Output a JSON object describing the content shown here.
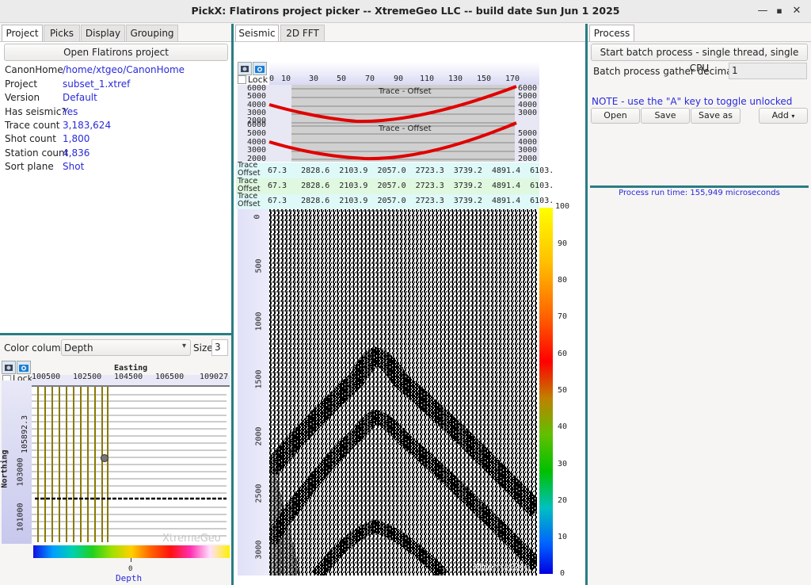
{
  "window": {
    "title": "PickX: Flatirons project picker -- XtremeGeo LLC -- build date Sun Jun 1 2025"
  },
  "left": {
    "tabs": [
      "Project",
      "Picks",
      "Display",
      "Grouping"
    ],
    "open_button": "Open Flatirons project",
    "info": [
      {
        "label": "CanonHome",
        "value": "/home/xtgeo/CanonHome"
      },
      {
        "label": "Project",
        "value": "subset_1.xtref"
      },
      {
        "label": "Version",
        "value": "Default"
      },
      {
        "label": "Has seismic?",
        "value": "Yes"
      },
      {
        "label": "Trace count",
        "value": "3,183,624"
      },
      {
        "label": "Shot count",
        "value": "1,800"
      },
      {
        "label": "Station count",
        "value": "4,836"
      },
      {
        "label": "Sort plane",
        "value": "Shot"
      }
    ]
  },
  "map": {
    "color_column_label": "Color column",
    "color_column_value": "Depth",
    "size_label": "Size",
    "size_value": "3",
    "lock_label": "Lock",
    "x_title": "Easting",
    "x_ticks": [
      "100500",
      "102500",
      "104500",
      "106500",
      "109027"
    ],
    "y_title": "Northing",
    "y_ticks": [
      "105892.3",
      "103000",
      "101000"
    ],
    "watermark": "XtremeGeo",
    "colorbar_tick": "0",
    "colorbar_label": "Depth"
  },
  "center": {
    "tabs": [
      "Seismic",
      "2D FFT"
    ],
    "lock_label": "Lock",
    "trace_axis": [
      "0",
      "10",
      "30",
      "50",
      "70",
      "90",
      "110",
      "130",
      "150",
      "170"
    ],
    "plot_title": "Trace - Offset",
    "offset_yticks_a": [
      "6000",
      "5000",
      "4000",
      "3000",
      "2000"
    ],
    "offset_yticks_b": [
      "6000",
      "5000",
      "4000",
      "3000",
      "2000"
    ],
    "header_rows": [
      {
        "label1": "Trace",
        "label2": "Offset",
        "values": "67.3   2828.6  2103.9  2057.0  2723.3  3739.2  4891.4  6103."
      },
      {
        "label1": "Trace",
        "label2": "Offset",
        "values": "67.3   2828.6  2103.9  2057.0  2723.3  3739.2  4891.4  6103."
      },
      {
        "label1": "Trace",
        "label2": "Offset",
        "values": "67.3   2828.6  2103.9  2057.0  2723.3  3739.2  4891.4  6103."
      }
    ],
    "time_ticks": [
      "0",
      "500",
      "1000",
      "1500",
      "2000",
      "2500",
      "3000"
    ],
    "colorbar_ticks": [
      "100",
      "90",
      "80",
      "70",
      "60",
      "50",
      "40",
      "30",
      "20",
      "10",
      "0"
    ],
    "watermark": "XtremeGeo"
  },
  "right": {
    "tab": "Process",
    "batch_button": "Start batch process - single thread, single CPU",
    "decimation_label": "Batch process gather decimation",
    "decimation_value": "1",
    "note": "NOTE - use the \"A\" key to toggle unlocked processes",
    "buttons": [
      "Open",
      "Save",
      "Save as",
      "Add"
    ],
    "run_time": "Process run time: 155,949 microseconds"
  },
  "colors": {
    "accent": "#2a7d84",
    "link": "#2a2ad8",
    "pick": "#e00000",
    "grid_line": "#8a7a00"
  }
}
